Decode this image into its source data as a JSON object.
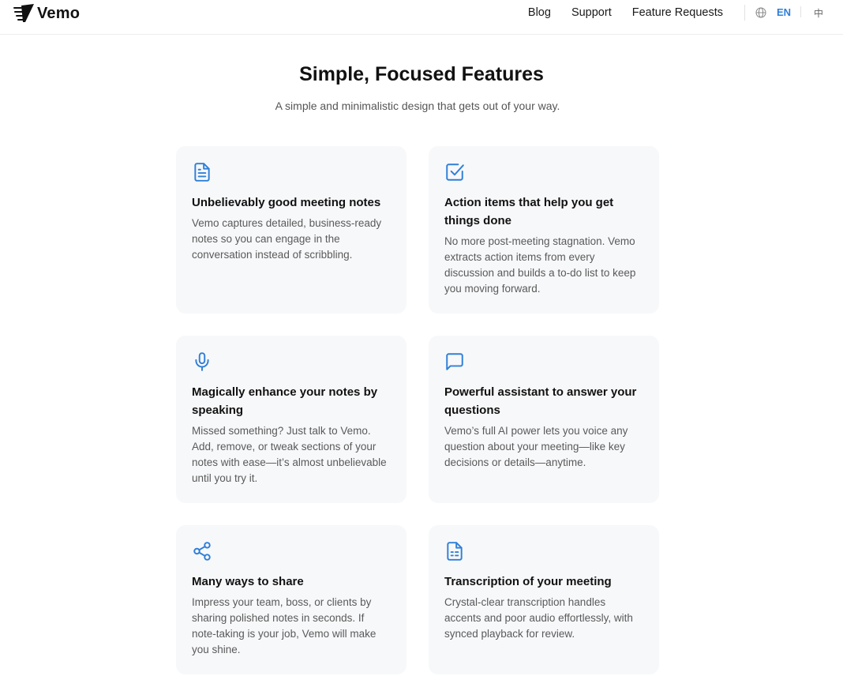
{
  "brand": {
    "name": "Vemo",
    "logo_icon": "vemo-logo-icon"
  },
  "nav": {
    "links": [
      "Blog",
      "Support",
      "Feature Requests"
    ],
    "lang_icon": "globe-icon",
    "lang_active": "EN",
    "lang_other": "中"
  },
  "hero": {
    "title": "Simple, Focused Features",
    "subtitle": "A simple and minimalistic design that gets out of your way."
  },
  "colors": {
    "accent": "#2f7fd8",
    "card_bg": "#f7f8fa"
  },
  "features": [
    {
      "icon": "document-icon",
      "title": "Unbelievably good meeting notes",
      "desc": "Vemo captures detailed, business-ready notes so you can engage in the conversation instead of scribbling."
    },
    {
      "icon": "checkbox-icon",
      "title": "Action items that help you get things done",
      "desc": "No more post-meeting stagnation. Vemo extracts action items from every discussion and builds a to-do list to keep you moving forward."
    },
    {
      "icon": "microphone-icon",
      "title": "Magically enhance your notes by speaking",
      "desc": "Missed something? Just talk to Vemo. Add, remove, or tweak sections of your notes with ease—it’s almost unbelievable until you try it."
    },
    {
      "icon": "chat-bubble-icon",
      "title": "Powerful assistant to answer your questions",
      "desc": "Vemo’s full AI power lets you voice any question about your meeting—like key decisions or details—anytime."
    },
    {
      "icon": "share-icon",
      "title": "Many ways to share",
      "desc": "Impress your team, boss, or clients by sharing polished notes in seconds. If note-taking is your job, Vemo will make you shine."
    },
    {
      "icon": "transcript-icon",
      "title": "Transcription of your meeting",
      "desc": "Crystal-clear transcription handles accents and poor audio effortlessly, with synced playback for review."
    }
  ]
}
